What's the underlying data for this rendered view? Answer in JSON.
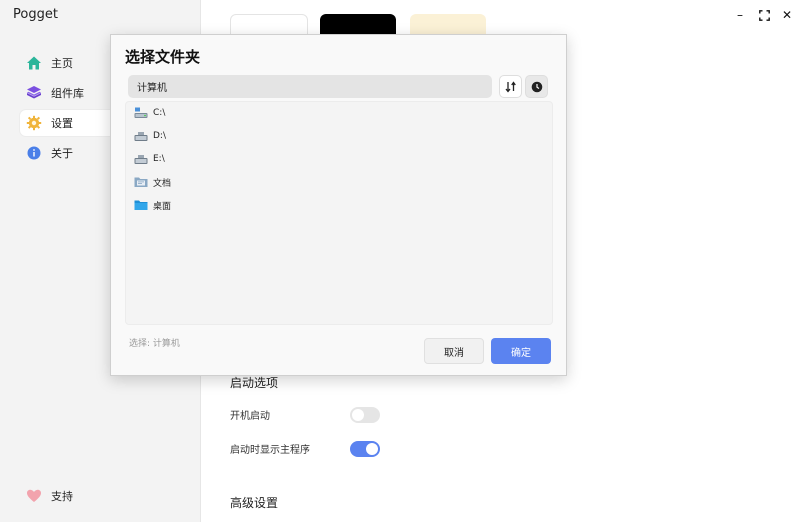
{
  "app": {
    "title": "Pogget"
  },
  "sidebar": {
    "items": [
      {
        "label": "主页"
      },
      {
        "label": "组件库"
      },
      {
        "label": "设置"
      },
      {
        "label": "关于"
      }
    ],
    "support_label": "支持"
  },
  "window_controls": {
    "minimize": "–",
    "maximize": "⛶",
    "close": "✕"
  },
  "main": {
    "swatch_colors": [
      "#ffffff",
      "#000000",
      "#fbf1d6"
    ],
    "startup": {
      "title": "启动选项",
      "options": [
        {
          "label": "开机启动",
          "enabled": false
        },
        {
          "label": "启动时显示主程序",
          "enabled": true
        }
      ]
    },
    "advanced_title": "高级设置"
  },
  "dialog": {
    "title": "选择文件夹",
    "path": "计算机",
    "items": [
      {
        "label": "C:\\",
        "icon": "drive-system-icon"
      },
      {
        "label": "D:\\",
        "icon": "drive-icon"
      },
      {
        "label": "E:\\",
        "icon": "drive-icon"
      },
      {
        "label": "文档",
        "icon": "documents-folder-icon"
      },
      {
        "label": "桌面",
        "icon": "desktop-folder-icon"
      }
    ],
    "selected": "选择: 计算机",
    "cancel_label": "取消",
    "ok_label": "确定"
  },
  "colors": {
    "accent": "#5b83f0",
    "home_icon": "#2bb59a",
    "components_icon": "#7b4fe0",
    "settings_icon": "#f0b43a",
    "about_icon": "#4a7fe8",
    "support_icon": "#f2a3ad"
  }
}
